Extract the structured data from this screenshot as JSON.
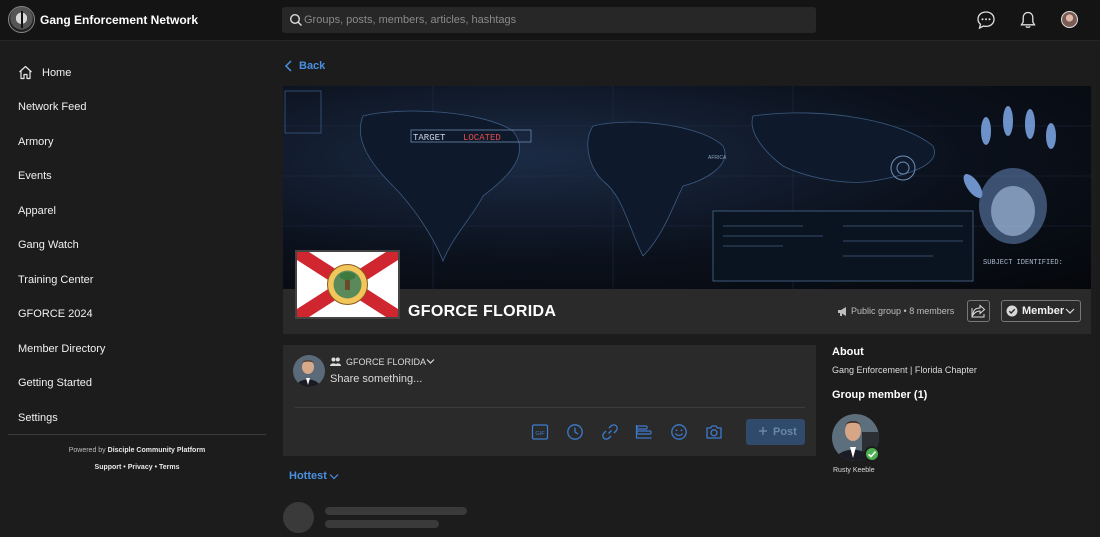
{
  "header": {
    "brand": "Gang Enforcement Network",
    "search_placeholder": "Groups, posts, members, articles, hashtags"
  },
  "sidebar": {
    "items": [
      {
        "label": "Home"
      },
      {
        "label": "Network Feed"
      },
      {
        "label": "Armory"
      },
      {
        "label": "Events"
      },
      {
        "label": "Apparel"
      },
      {
        "label": "Gang Watch"
      },
      {
        "label": "Training Center"
      },
      {
        "label": "GFORCE 2024"
      },
      {
        "label": "Member Directory"
      },
      {
        "label": "Getting Started"
      },
      {
        "label": "Settings"
      }
    ],
    "powered_prefix": "Powered by",
    "powered_brand": "Disciple Community Platform",
    "links": [
      "Support",
      "Privacy",
      "Terms"
    ]
  },
  "main": {
    "back_label": "Back",
    "cover_text_1": "TARGET",
    "cover_text_2": "LOCATED",
    "cover_text_3": "SUBJECT IDENTIFIED:",
    "cover_text_4": "AFRICA",
    "group": {
      "name": "GFORCE FLORIDA",
      "visibility": "Public group",
      "members": "8 members",
      "member_button": "Member"
    },
    "composer": {
      "group_label": "GFORCE FLORIDA",
      "prompt": "Share something...",
      "post_label": "Post",
      "tool_gif": "GIF"
    },
    "sort_label": "Hottest"
  },
  "right": {
    "about_heading": "About",
    "about_text": "Gang Enforcement | Florida Chapter",
    "members_heading": "Group member (1)",
    "member_name": "Rusty Keeble"
  },
  "colors": {
    "accent": "#4a90e2",
    "background": "#1c1c1c",
    "card": "#2a2a2a",
    "success": "#4caf50"
  }
}
